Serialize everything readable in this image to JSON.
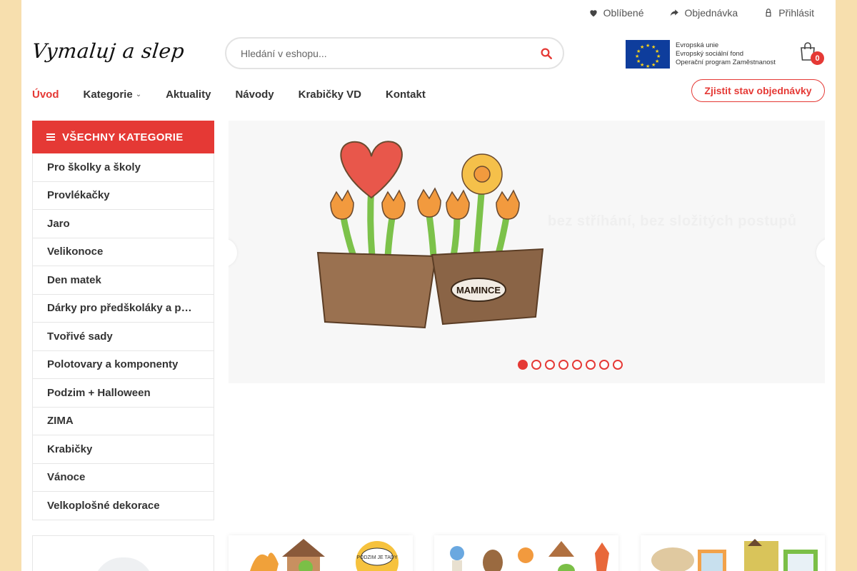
{
  "topbar": {
    "favorites": "Oblíbené",
    "order": "Objednávka",
    "login": "Přihlásit"
  },
  "logo": {
    "text": "Vymaluj a slep"
  },
  "search": {
    "placeholder": "Hledání v eshopu...",
    "value": ""
  },
  "eu_banner": {
    "line1": "Evropská unie",
    "line2": "Evropský sociální fond",
    "line3": "Operační program Zaměstnanost"
  },
  "cart": {
    "count": "0"
  },
  "nav": {
    "items": [
      {
        "label": "Úvod",
        "active": true
      },
      {
        "label": "Kategorie",
        "dropdown": true
      },
      {
        "label": "Aktuality"
      },
      {
        "label": "Návody"
      },
      {
        "label": "Krabičky VD"
      },
      {
        "label": "Kontakt"
      }
    ],
    "order_status_button": "Zjistit stav objednávky"
  },
  "sidebar": {
    "header": "VŠECHNY KATEGORIE",
    "items": [
      "Pro školky a školy",
      "Provlékačky",
      "Jaro",
      "Velikonoce",
      "Den matek",
      "Dárky pro předškoláky a p…",
      "Tvořivé sady",
      "Polotovary a komponenty",
      "Podzim + Halloween",
      "ZIMA",
      "Krabičky",
      "Vánoce",
      "Velkoplošné dekorace"
    ]
  },
  "slider": {
    "caption": "bez stříhání, bez složitých postupů",
    "pot_label": "MAMINCE",
    "slide_count": 8,
    "active_slide": 1
  },
  "cards": {
    "card1_label": "PODZIM JE TADY"
  },
  "colors": {
    "accent": "#e53935",
    "page_background": "#f7dfae"
  }
}
